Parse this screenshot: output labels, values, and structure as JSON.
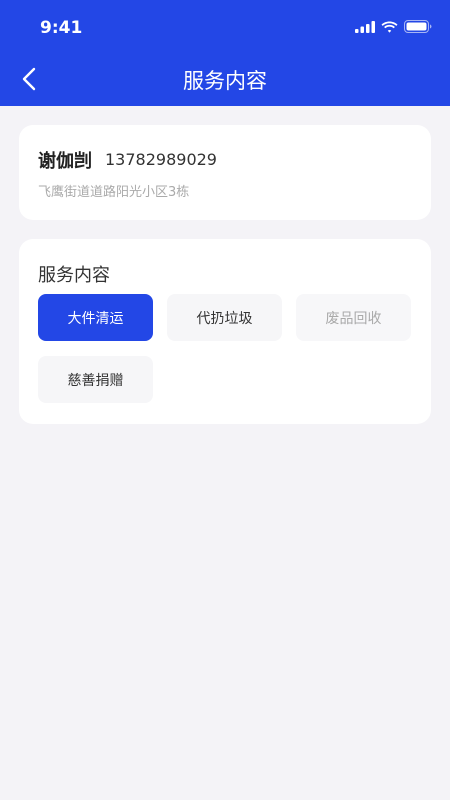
{
  "status_bar": {
    "time": "9:41"
  },
  "nav": {
    "title": "服务内容"
  },
  "user": {
    "name": "谢伽剀",
    "phone": "13782989029",
    "address": "飞鹰街道道路阳光小区3栋"
  },
  "service": {
    "title": "服务内容",
    "options": [
      {
        "label": "大件清运",
        "state": "selected"
      },
      {
        "label": "代扔垃圾",
        "state": "normal"
      },
      {
        "label": "废品回收",
        "state": "disabled"
      },
      {
        "label": "慈善捐赠",
        "state": "normal"
      }
    ]
  },
  "colors": {
    "primary": "#2347e6",
    "background": "#f4f3f7"
  }
}
